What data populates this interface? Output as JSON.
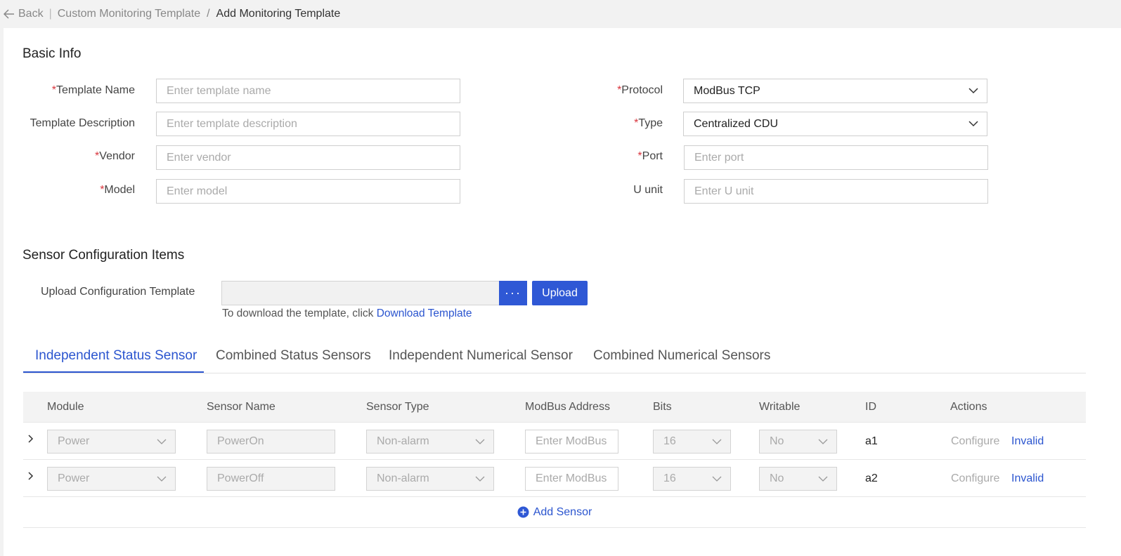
{
  "breadcrumb": {
    "back": "Back",
    "parent": "Custom Monitoring Template",
    "current": "Add Monitoring Template"
  },
  "basic_info": {
    "title": "Basic Info",
    "left_fields": [
      {
        "label": "Template Name",
        "required": "*",
        "placeholder": "Enter template name"
      },
      {
        "label": "Template Description",
        "required": "",
        "placeholder": "Enter template description"
      },
      {
        "label": "Vendor",
        "required": "*",
        "placeholder": "Enter vendor"
      },
      {
        "label": "Model",
        "required": "*",
        "placeholder": "Enter model"
      }
    ],
    "protocol": {
      "label": "Protocol",
      "required": "*",
      "value": "ModBus TCP"
    },
    "type": {
      "label": "Type",
      "required": "*",
      "value": "Centralized CDU"
    },
    "port": {
      "label": "Port",
      "required": "*",
      "placeholder": "Enter port"
    },
    "u_unit": {
      "label": "U unit",
      "required": "",
      "placeholder": "Enter U unit"
    }
  },
  "sensor_config": {
    "title": "Sensor Configuration Items",
    "upload_label": "Upload Configuration Template",
    "browse_label": "···",
    "upload_button": "Upload",
    "hint_text": "To download the template, click ",
    "download_link": "Download Template"
  },
  "tabs": [
    {
      "label": "Independent Status Sensor",
      "active": true
    },
    {
      "label": "Combined Status Sensors",
      "active": false
    },
    {
      "label": "Independent Numerical Sensor",
      "active": false
    },
    {
      "label": "Combined Numerical Sensors",
      "active": false
    }
  ],
  "table": {
    "headers": [
      "Module",
      "Sensor Name",
      "Sensor Type",
      "ModBus Address",
      "Bits",
      "Writable",
      "ID",
      "Actions"
    ],
    "rows": [
      {
        "module": "Power",
        "sensor_name": "PowerOn",
        "sensor_type": "Non-alarm",
        "modbus_placeholder": "Enter ModBus",
        "bits": "16",
        "writable": "No",
        "id": "a1",
        "configure": "Configure",
        "invalid": "Invalid"
      },
      {
        "module": "Power",
        "sensor_name": "PowerOff",
        "sensor_type": "Non-alarm",
        "modbus_placeholder": "Enter ModBus",
        "bits": "16",
        "writable": "No",
        "id": "a2",
        "configure": "Configure",
        "invalid": "Invalid"
      }
    ],
    "add_label": "Add Sensor"
  },
  "colors": {
    "accent": "#2f58d5",
    "required": "#d9363e"
  },
  "icons": {
    "back": "arrow-left-icon",
    "chevron": "chevron-down-icon",
    "expand": "chevron-right-icon",
    "add": "plus-circle-icon"
  }
}
